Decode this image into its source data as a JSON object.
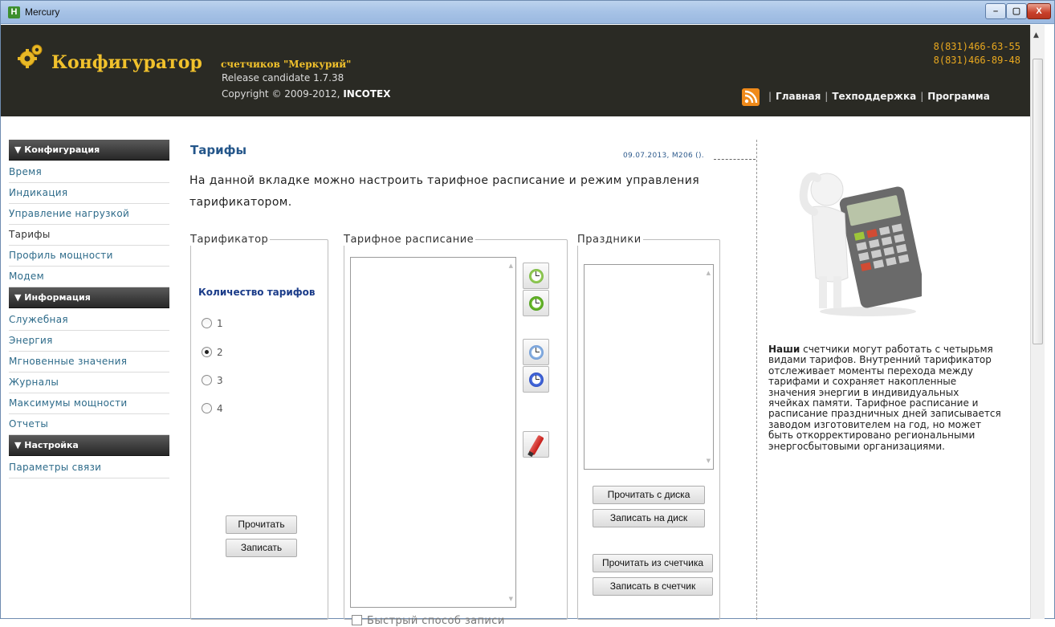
{
  "window": {
    "title": "Mercury",
    "app_icon": "H",
    "buttons": {
      "minimize": "–",
      "maximize": "▢",
      "close": "X"
    }
  },
  "header": {
    "logo_title": "Конфигуратор",
    "logo_subtitle": "счетчиков \"Меркурий\"",
    "release": "Release candidate 1.7.38",
    "copyright_prefix": "Copyright © 2009-2012, ",
    "copyright_company": "INCOTEX",
    "phones": [
      "8(831)466-63-55",
      "8(831)466-89-48"
    ],
    "nav": [
      "Главная",
      "Техподдержка",
      "Программа"
    ]
  },
  "sidebar": {
    "sections": [
      {
        "title": "▼ Конфигурация",
        "items": [
          "Время",
          "Индикация",
          "Управление нагрузкой",
          "Тарифы",
          "Профиль мощности",
          "Модем"
        ]
      },
      {
        "title": "▼ Информация",
        "items": [
          "Служебная",
          "Энергия",
          "Мгновенные значения",
          "Журналы",
          "Максимумы мощности",
          "Отчеты"
        ]
      },
      {
        "title": "▼ Настройка",
        "items": [
          "Параметры связи"
        ]
      }
    ],
    "active_item": "Тарифы"
  },
  "page": {
    "title": "Тарифы",
    "meta": "09.07.2013, M206 ().",
    "description": "На данной вкладке можно настроить тарифное расписание и режим управления тарификатором."
  },
  "tariffer": {
    "legend": "Тарификатор",
    "qty_label": "Количество тарифов",
    "options": [
      "1",
      "2",
      "3",
      "4"
    ],
    "selected": "2",
    "read_label": "Прочитать",
    "write_label": "Записать"
  },
  "schedule": {
    "legend": "Тарифное расписание",
    "fast_write_label": "Быстрый способ записи",
    "fast_write_checked": false,
    "tool_icons": [
      "clock-green-icon",
      "clock-refresh-green-icon",
      "clock-blue-icon",
      "clock-refresh-blue-icon",
      "pen-icon"
    ]
  },
  "holidays": {
    "legend": "Праздники",
    "read_disk_label": "Прочитать с диска",
    "write_disk_label": "Записать на диск",
    "read_meter_label": "Прочитать из счетчика",
    "write_meter_label": "Записать в счетчик"
  },
  "promo": {
    "text_bold": "Наши",
    "text": " счетчики могут работать с четырьмя видами тарифов. Внутренний тарификатор отслеживает моменты перехода между тарифами и сохраняет накопленные значения энергии в индивидуальных ячейках памяти. Тарифное расписание и расписание праздничных дней записывается заводом изготовителем на год, но может быть откорректировано региональными энергосбытовыми организациями."
  },
  "colors": {
    "header_bg": "#2a2a24",
    "logo": "#f1c12c",
    "phones": "#e9a81f",
    "link": "#2e6b8a",
    "title": "#24568a"
  }
}
